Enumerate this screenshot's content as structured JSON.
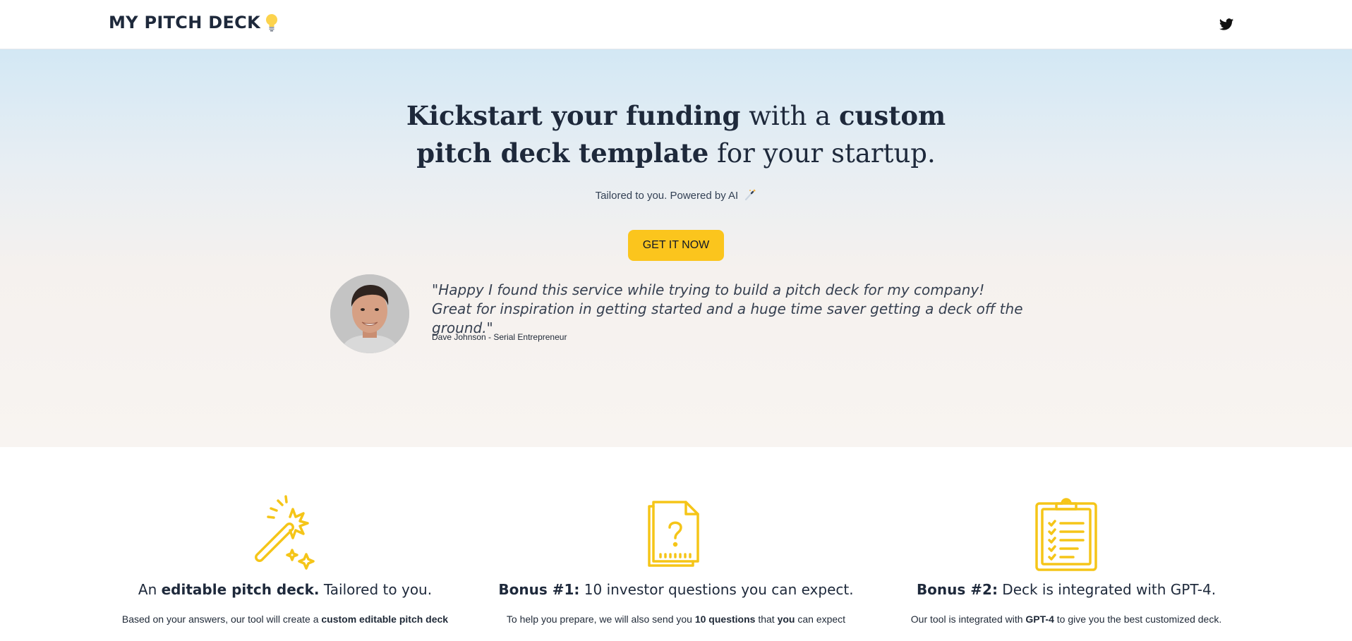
{
  "header": {
    "logo_text": "MY PITCH DECK",
    "logo_icon": "lightbulb-icon",
    "social_icon": "twitter-icon"
  },
  "hero": {
    "headline_parts": [
      "Kickstart your funding",
      " with a ",
      "custom",
      "pitch deck template",
      " for your startup."
    ],
    "tagline": "Tailored to you. Powered by AI",
    "tagline_icon": "magic-wand-icon",
    "cta_label": "GET IT NOW"
  },
  "testimonial": {
    "quote": "\"Happy I found this service while trying to build a pitch deck for my company! Great for inspiration in getting started and a huge time saver getting a deck off the ground.\"",
    "author": "Dave Johnson - Serial Entrepreneur"
  },
  "features": [
    {
      "icon": "magic-wand-icon",
      "title_pre": "An ",
      "title_bold": "editable pitch deck.",
      "title_post": " Tailored to you.",
      "desc_pre": "Based on your answers, our tool will create a ",
      "desc_bold": "custom editable pitch deck",
      "desc_post": ""
    },
    {
      "icon": "question-document-icon",
      "title_pre": "",
      "title_bold": "Bonus #1:",
      "title_post": " 10 investor questions you can expect.",
      "desc_pre": "To help you prepare, we will also send you ",
      "desc_bold": "10 questions",
      "desc_mid": " that ",
      "desc_bold2": "you",
      "desc_post": " can expect"
    },
    {
      "icon": "clipboard-checklist-icon",
      "title_pre": "",
      "title_bold": "Bonus #2:",
      "title_post": " Deck is integrated with GPT-4.",
      "desc_pre": "Our tool is integrated with ",
      "desc_bold": "GPT-4",
      "desc_post": " to give you the best customized deck."
    }
  ],
  "colors": {
    "accent": "#fbc51d",
    "icon_yellow": "#f5c518",
    "text_dark": "#1e293b"
  }
}
